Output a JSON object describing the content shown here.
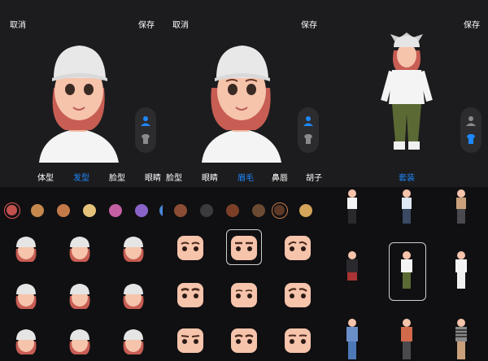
{
  "panels": [
    {
      "cancel_label": "取消",
      "save_label": "保存",
      "tabs": [
        {
          "label": "体型",
          "active": false
        },
        {
          "label": "发型",
          "active": true
        },
        {
          "label": "脸型",
          "active": false
        },
        {
          "label": "眼睛",
          "active": false
        }
      ],
      "swatches": [
        "#c2514e",
        "#c7884d",
        "#c27a48",
        "#e5c27a",
        "#c45fa3",
        "#8a63c9",
        "#4a86d6"
      ],
      "selected_swatch": 0
    },
    {
      "tabs": [
        {
          "label": "脸型",
          "active": false
        },
        {
          "label": "眼睛",
          "active": false
        },
        {
          "label": "眉毛",
          "active": true
        },
        {
          "label": "鼻唇",
          "active": false
        },
        {
          "label": "胡子",
          "active": false
        }
      ],
      "swatches": [
        "#8a4d33",
        "#3b3b3d",
        "#7b3f28",
        "#6b4a33",
        "#5d3826",
        "#d4a55a"
      ],
      "selected_swatch": 4
    },
    {
      "save_label": "保存",
      "tabs": [
        {
          "label": "套装",
          "active": true
        }
      ]
    }
  ],
  "icons": {
    "toggle_head": "person-icon",
    "toggle_body": "shirt-icon"
  },
  "colors": {
    "accent": "#1e88ff",
    "background": "#1c1c1e",
    "sheet": "#101012"
  }
}
